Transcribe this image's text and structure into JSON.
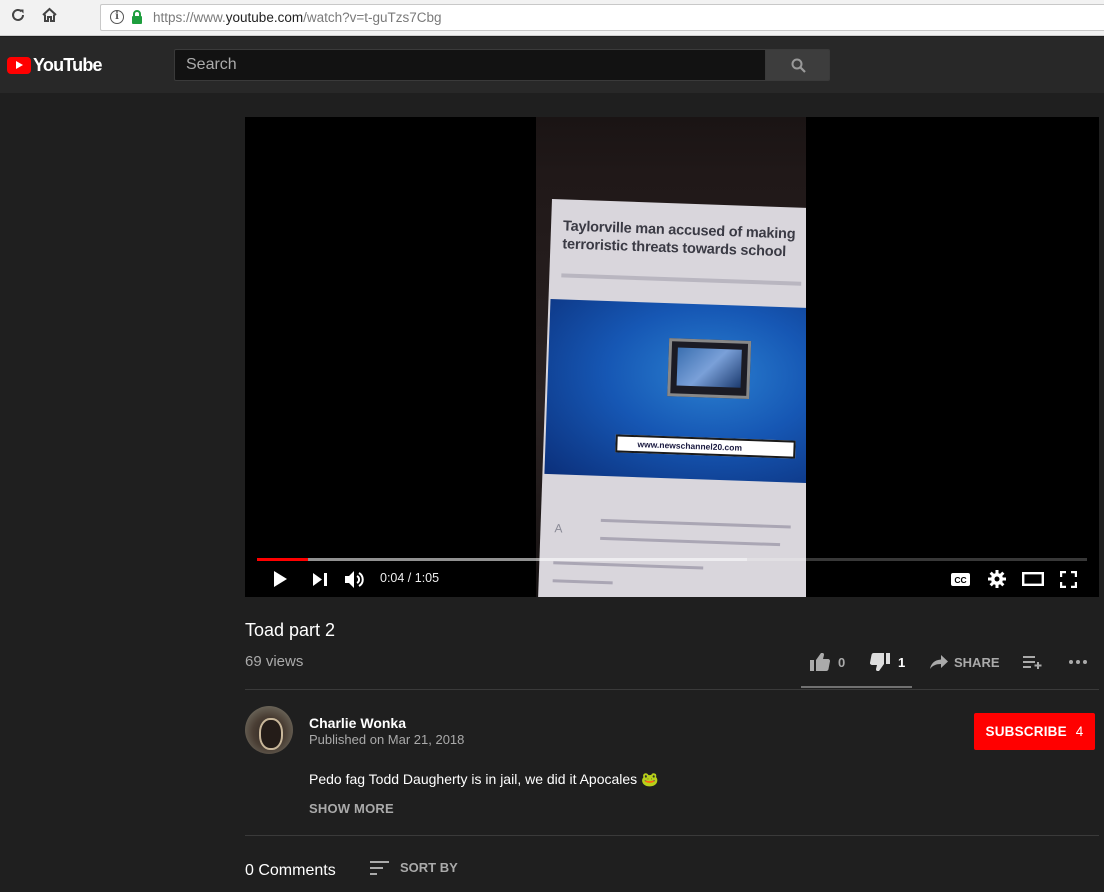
{
  "browser": {
    "url_prefix": "https://www.",
    "url_domain": "youtube.com",
    "url_path": "/watch?v=t-guTzs7Cbg"
  },
  "header": {
    "logo_text": "YouTube",
    "search_placeholder": "Search"
  },
  "player": {
    "frame_headline": "Taylorville man accused of making terroristic threats towards school",
    "frame_url_text": "www.newschannel20.com",
    "current_time": "0:04",
    "duration": "1:05",
    "time_display": "0:04 / 1:05",
    "progress_fraction": 0.0615,
    "buffered_fraction": 0.59
  },
  "video": {
    "title": "Toad part 2",
    "views": "69 views",
    "likes": "0",
    "dislikes": "1",
    "share_label": "SHARE",
    "like_fraction": 0.0
  },
  "owner": {
    "channel_name": "Charlie Wonka",
    "published": "Published on Mar 21, 2018",
    "subscribe_label": "SUBSCRIBE",
    "subscriber_count": "4"
  },
  "description": {
    "text": "Pedo fag Todd Daugherty is in jail, we did it Apocales 🐸",
    "show_more": "SHOW MORE"
  },
  "comments": {
    "count_label": "0 Comments",
    "sort_label": "SORT BY"
  },
  "colors": {
    "accent": "#ff0000",
    "page_bg": "#1f1f1f",
    "header_bg": "#282828"
  },
  "icons": [
    "reload-icon",
    "home-icon",
    "info-icon",
    "lock-icon",
    "search-icon",
    "play-icon",
    "next-icon",
    "volume-icon",
    "captions-icon",
    "settings-icon",
    "theater-icon",
    "fullscreen-icon",
    "thumb-up-icon",
    "thumb-down-icon",
    "share-icon",
    "add-to-playlist-icon",
    "more-icon",
    "sort-icon"
  ]
}
